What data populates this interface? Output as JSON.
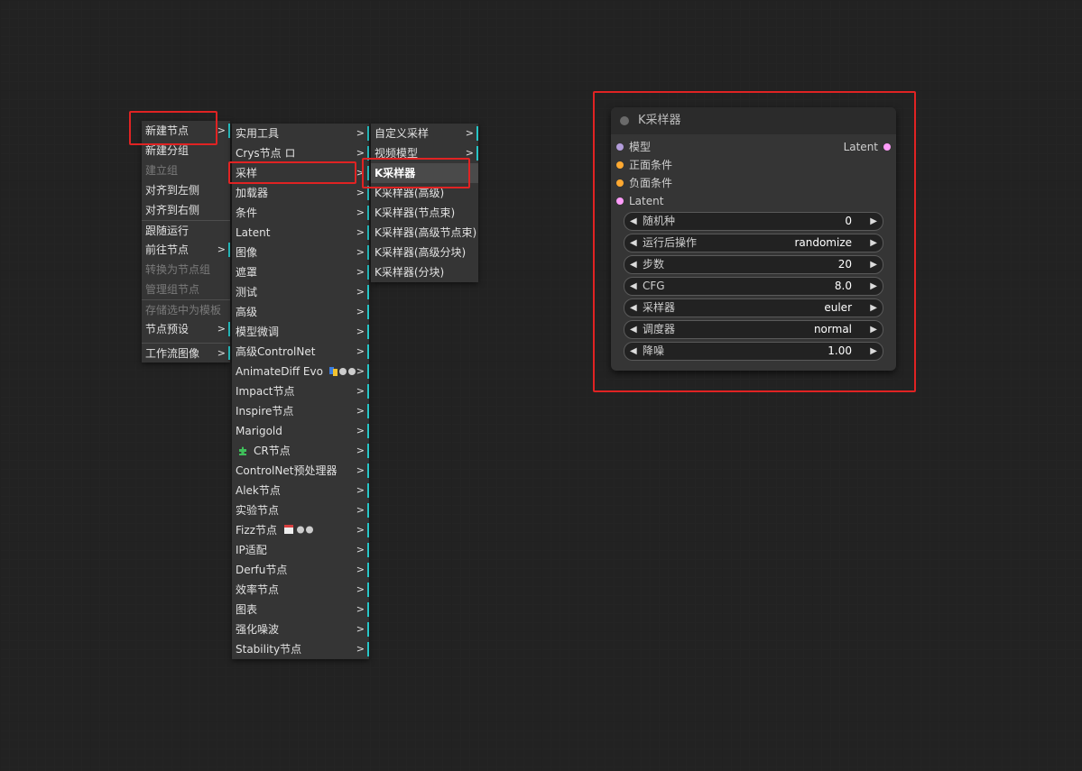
{
  "colors": {
    "canvas_bg": "#222222",
    "menu_bg": "#353535",
    "submenu_marker": "#27c5c7",
    "highlight_box": "#e02323",
    "node_bg": "#353535",
    "slot_model": "#b39ddb",
    "slot_conditioning": "#ffa931",
    "slot_latent": "#ff9cf9"
  },
  "menu_main": {
    "items": [
      {
        "label": "新建节点",
        "submenu": true,
        "arrow": ">"
      },
      {
        "label": "新建分组"
      },
      {
        "label": "建立组",
        "disabled": true
      },
      {
        "label": "对齐到左侧"
      },
      {
        "label": "对齐到右侧"
      },
      {
        "label": "跟随运行"
      },
      {
        "label": "前往节点",
        "submenu": true,
        "arrow": ">"
      },
      {
        "label": "转换为节点组",
        "disabled": true
      },
      {
        "label": "管理组节点",
        "disabled": true
      },
      {
        "label": "存储选中为模板",
        "disabled": true
      },
      {
        "label": "节点预设",
        "submenu": true,
        "arrow": ">"
      },
      {
        "label": "工作流图像",
        "submenu": true,
        "arrow": ">"
      }
    ]
  },
  "menu_categories": {
    "items": [
      {
        "label": "实用工具",
        "arrow": ">"
      },
      {
        "label": "Crys节点 ロ",
        "arrow": ">"
      },
      {
        "label": "采样",
        "arrow": ">"
      },
      {
        "label": "加载器",
        "arrow": ">"
      },
      {
        "label": "条件",
        "arrow": ">"
      },
      {
        "label": "Latent",
        "arrow": ">"
      },
      {
        "label": "图像",
        "arrow": ">"
      },
      {
        "label": "遮罩",
        "arrow": ">"
      },
      {
        "label": "测试",
        "arrow": ">"
      },
      {
        "label": "高级",
        "arrow": ">"
      },
      {
        "label": "模型微调",
        "arrow": ">"
      },
      {
        "label": "高级ControlNet",
        "arrow": ">"
      },
      {
        "label": "AnimateDiff Evo",
        "arrow": ">",
        "icon": "animatediff-badges-icon"
      },
      {
        "label": "Impact节点",
        "arrow": ">"
      },
      {
        "label": "Inspire节点",
        "arrow": ">"
      },
      {
        "label": "Marigold",
        "arrow": ">"
      },
      {
        "label": "CR节点",
        "arrow": ">",
        "icon": "puzzle-icon"
      },
      {
        "label": "ControlNet预处理器",
        "arrow": ">"
      },
      {
        "label": "Alek节点",
        "arrow": ">"
      },
      {
        "label": "实验节点",
        "arrow": ">"
      },
      {
        "label": "Fizz节点",
        "arrow": ">",
        "icon": "fizz-badges-icon"
      },
      {
        "label": "IP适配",
        "arrow": ">"
      },
      {
        "label": "Derfu节点",
        "arrow": ">"
      },
      {
        "label": "效率节点",
        "arrow": ">"
      },
      {
        "label": "图表",
        "arrow": ">"
      },
      {
        "label": "强化噪波",
        "arrow": ">"
      },
      {
        "label": "Stability节点",
        "arrow": ">"
      }
    ]
  },
  "menu_sampling": {
    "items": [
      {
        "label": "自定义采样",
        "arrow": ">",
        "submenu": true
      },
      {
        "label": "视频模型",
        "arrow": ">",
        "submenu": true
      },
      {
        "label": "K采样器",
        "active": true
      },
      {
        "label": "K采样器(高级)"
      },
      {
        "label": "K采样器(节点束)"
      },
      {
        "label": "K采样器(高级节点束)"
      },
      {
        "label": "K采样器(高级分块)"
      },
      {
        "label": "K采样器(分块)"
      }
    ]
  },
  "node": {
    "title": "K采样器",
    "inputs": [
      "模型",
      "正面条件",
      "负面条件",
      "Latent"
    ],
    "output": "Latent",
    "widgets": [
      {
        "label": "随机种",
        "value": "0"
      },
      {
        "label": "运行后操作",
        "value": "randomize"
      },
      {
        "label": "步数",
        "value": "20"
      },
      {
        "label": "CFG",
        "value": "8.0"
      },
      {
        "label": "采样器",
        "value": "euler"
      },
      {
        "label": "调度器",
        "value": "normal"
      },
      {
        "label": "降噪",
        "value": "1.00"
      }
    ],
    "arrow_left": "◀",
    "arrow_right": "▶"
  }
}
